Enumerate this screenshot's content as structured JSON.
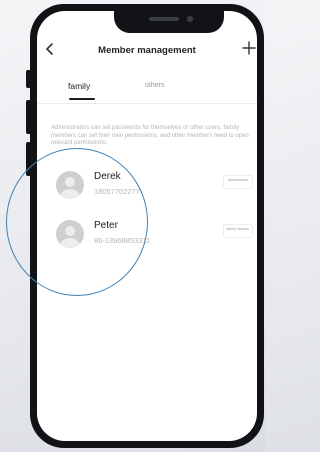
{
  "header": {
    "back_icon": "chevron-left-icon",
    "title": "Member management",
    "add_icon": "plus-icon"
  },
  "tabs": [
    {
      "label": "family",
      "selected": true
    },
    {
      "label": "others",
      "selected": false
    }
  ],
  "description": "Administrators can set passwords for themselves or other users, family members can set their own permissions, and other members need to open relevant permissions.",
  "members": [
    {
      "name": "Derek",
      "phone": "18057702277",
      "role": "administrator"
    },
    {
      "name": "Peter",
      "phone": "86-13968853311",
      "role": "family member"
    }
  ],
  "colors": {
    "highlight_circle": "#3f83b8",
    "phone_frame": "#121316",
    "active_tab": "#1f1f1f"
  }
}
